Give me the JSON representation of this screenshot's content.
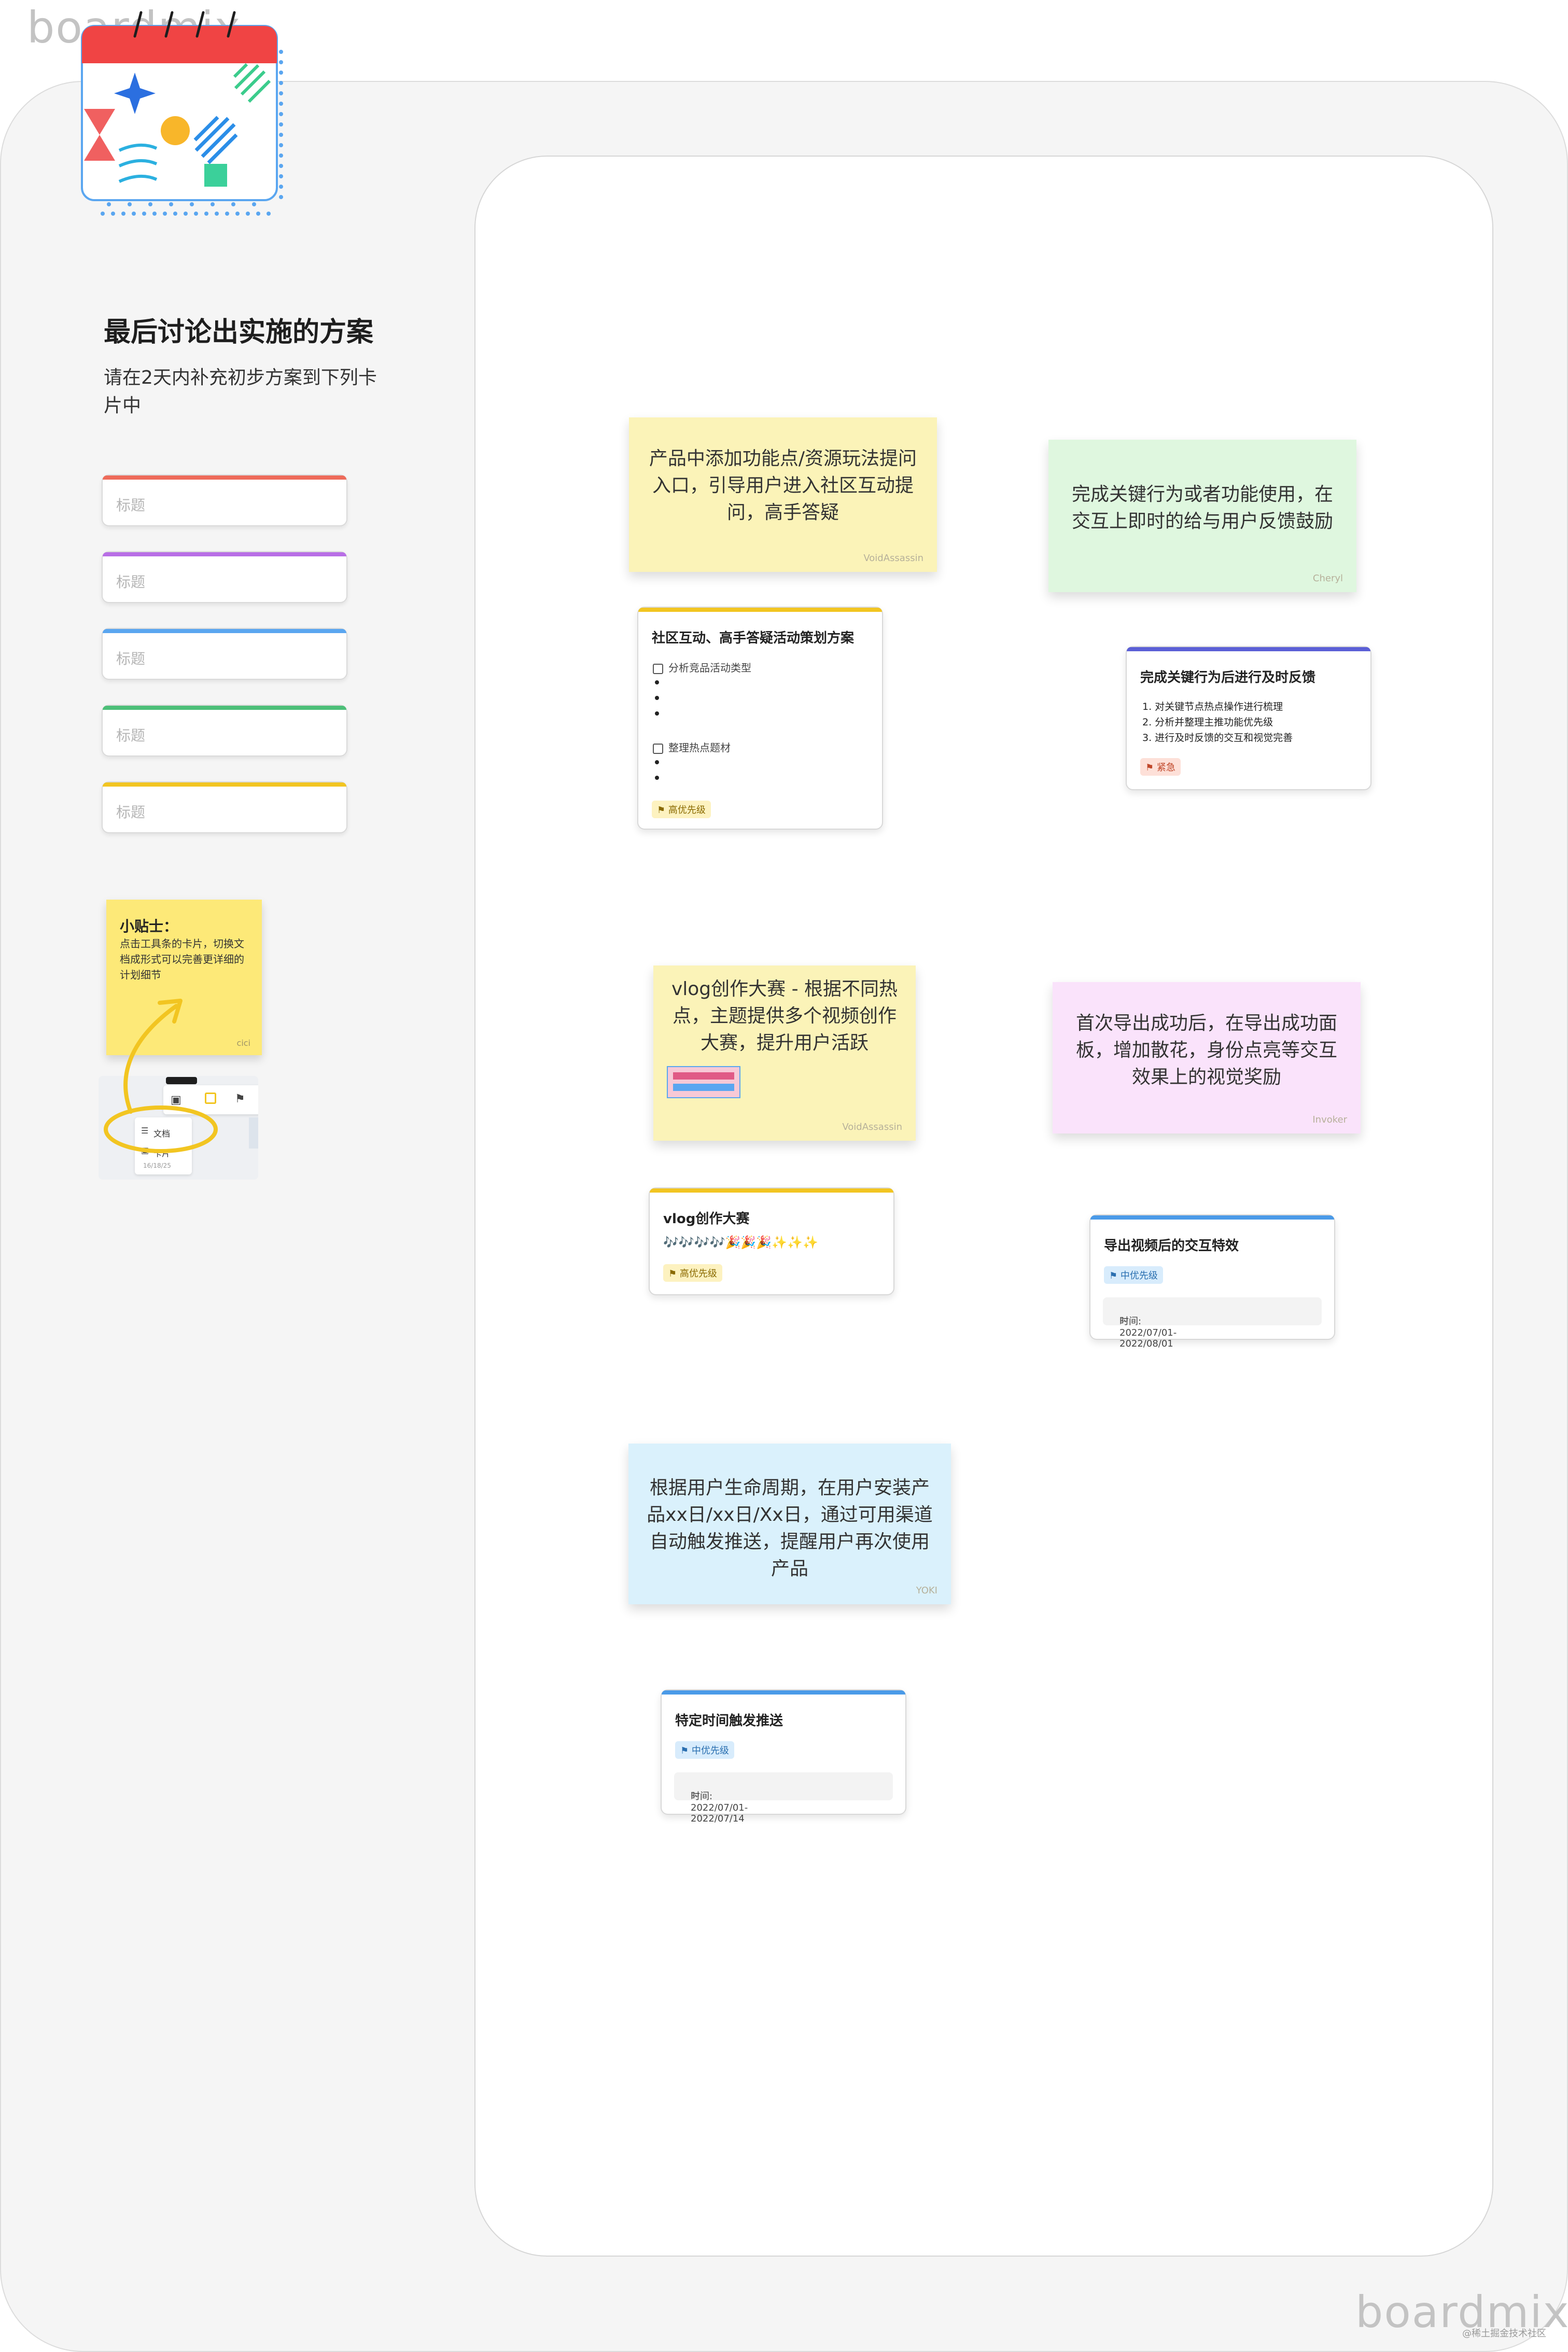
{
  "watermark_top": "boardmix",
  "watermark_bottom": "boardmix",
  "credit": "@稀土掘金技术社区",
  "sidebar": {
    "title": "最后讨论出实施的方案",
    "subtitle": "请在2天内补充初步方案到下列卡片中",
    "fields": [
      {
        "placeholder": "标题",
        "color": "#ee6b5a"
      },
      {
        "placeholder": "标题",
        "color": "#b86ee6"
      },
      {
        "placeholder": "标题",
        "color": "#5aa6f0"
      },
      {
        "placeholder": "标题",
        "color": "#4cbf78"
      },
      {
        "placeholder": "标题",
        "color": "#f2c521"
      }
    ],
    "tip": {
      "heading": "小贴士：",
      "body": "点击工具条的卡片，切换文档成形式可以完善更详细的计划细节",
      "author": "cici"
    },
    "mini_toolbar": {
      "menu_item": "文档",
      "menu_item2": "卡片",
      "sub": "16/18/25"
    }
  },
  "stickies": [
    {
      "text": "产品中添加功能点/资源玩法提问入口，引导用户进入社区互动提问，高手答疑",
      "author": "VoidAssassin",
      "color": "#fbf3b8"
    },
    {
      "text": "完成关键行为或者功能使用，在交互上即时的给与用户反馈鼓励",
      "author": "Cheryl",
      "color": "#dff7df"
    },
    {
      "text": "vlog创作大赛 - 根据不同热点，主题提供多个视频创作大赛，提升用户活跃",
      "author": "VoidAssassin",
      "color": "#fbf3b8"
    },
    {
      "text": "首次导出成功后，在导出成功面板，增加散花，身份点亮等交互效果上的视觉奖励",
      "author": "Invoker",
      "color": "#fae3fb"
    },
    {
      "text": "根据用户生命周期，在用户安装产品xx日/xx日/Xx日，通过可用渠道自动触发推送，提醒用户再次使用产品",
      "author": "YOKI",
      "color": "#daf1fc"
    }
  ],
  "cards": {
    "community": {
      "title": "社区互动、高手答疑活动策划方案",
      "task1": "分析竞品活动类型",
      "task2": "整理热点题材",
      "badge": "高优先级",
      "color": "#f2c521"
    },
    "feedback": {
      "title": "完成关键行为后进行及时反馈",
      "items": [
        "1.  对关键节点热点操作进行梳理",
        "2.  分析并整理主推功能优先级",
        "3.  进行及时反馈的交互和视觉完善"
      ],
      "badge": "紧急",
      "color": "#5b5fd6"
    },
    "vlog": {
      "title": "vlog创作大赛",
      "emoji": "🎶🎶🎶🎶🎉🎉🎉✨✨✨",
      "badge": "高优先级",
      "color": "#f2c521"
    },
    "export": {
      "title": "导出视频后的交互特效",
      "badge": "中优先级",
      "date": "时间: 2022/07/01-2022/08/01",
      "color": "#4a9ae8"
    },
    "push": {
      "title": "特定时间触发推送",
      "badge": "中优先级",
      "date": "时间: 2022/07/01-2022/07/14",
      "color": "#4a9ae8"
    }
  }
}
